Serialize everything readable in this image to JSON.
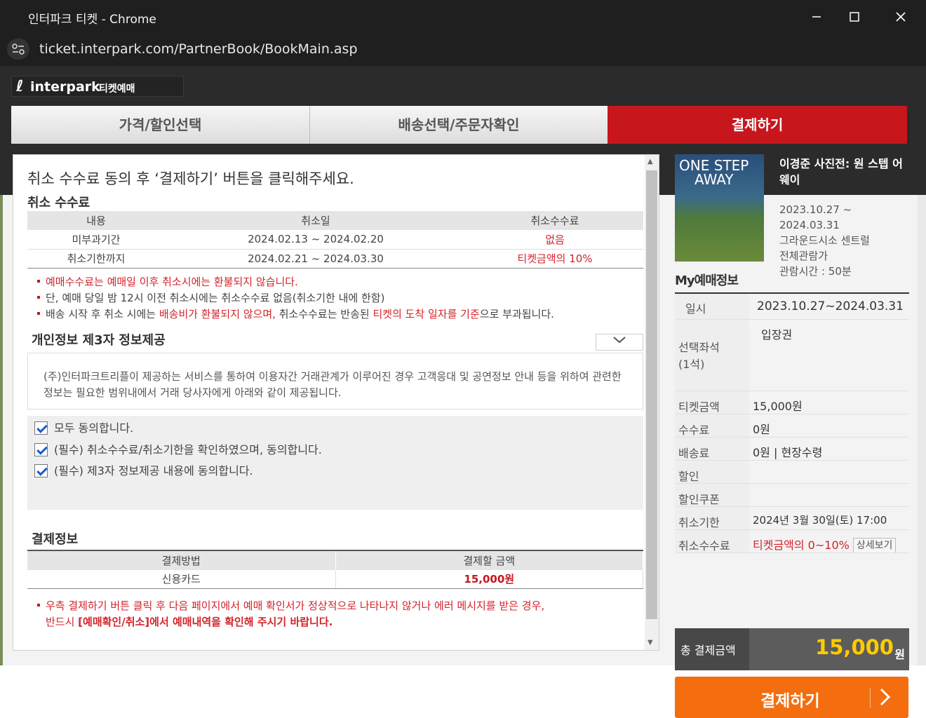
{
  "window": {
    "title": "인터파크 티켓 - Chrome",
    "url": "ticket.interpark.com/PartnerBook/BookMain.asp"
  },
  "logo": {
    "name": "interpark",
    "sub": "티켓예매"
  },
  "steps": [
    "가격/할인선택",
    "배송선택/주문자확인",
    "결제하기"
  ],
  "main": {
    "headline": "취소 수수료 동의 후 ‘결제하기’ 버튼을 클릭해주세요.",
    "cancel_fee": {
      "title": "취소 수수료",
      "headers": [
        "내용",
        "취소일",
        "취소수수료"
      ],
      "rows": [
        [
          "미부과기간",
          "2024.02.13 ~ 2024.02.20",
          "없음"
        ],
        [
          "취소기한까지",
          "2024.02.21 ~ 2024.03.30",
          "티켓금액의 10%"
        ]
      ],
      "notes": {
        "n1": "예매수수료는 예매일 이후 취소시에는 환불되지 않습니다.",
        "n2": "단, 예매 당일 밤 12시 이전 취소시에는 취소수수료 없음(취소기한 내에 한함)",
        "n3a": "배송 시작 후 취소 시에는 ",
        "n3b": "배송비가 환불되지 않으며,",
        "n3c": " 취소수수료는 반송된 ",
        "n3d": "티켓의 도착 일자를 기준",
        "n3e": "으로 부과됩니다."
      }
    },
    "privacy": {
      "title": "개인정보 제3자 정보제공",
      "text": "(주)인터파크트리플이 제공하는 서비스를 통하여 이용자간 거래관계가 이루어진 경우 고객응대 및 공연정보 안내 등을 위하여 관련한 정보는 필요한 범위내에서 거래 당사자에게 아래와 같이 제공됩니다."
    },
    "agree": {
      "all": "모두 동의합니다.",
      "cancel": "(필수) 취소수수료/취소기한을 확인하였으며, 동의합니다.",
      "third": "(필수) 제3자 정보제공 내용에 동의합니다."
    },
    "payment": {
      "title": "결제정보",
      "headers": [
        "결제방법",
        "결제할 금액"
      ],
      "method": "신용카드",
      "amount": "15,000원",
      "note1": "우측 결제하기 버튼 클릭 후 다음 페이지에서 예매 확인서가 정상적으로 나타나지 않거나 에러 메시지를 받은 경우,",
      "note2a": "반드시 ",
      "note2b": "[예매확인/취소]에서 예매내역을 확인해 주시기 바랍니다."
    }
  },
  "sidebar": {
    "poster": {
      "line1": "ONE STEP",
      "line2": "AWAY"
    },
    "show_title": "이경준 사진전: 원 스텝 어웨이",
    "period_start": "2023.10.27 ~",
    "period_end": "2024.03.31",
    "venue": "그라운드시소 센트럴",
    "rating": "전체관람가",
    "runtime": "관람시간 : 50분",
    "my_title": "My예매정보",
    "info": [
      {
        "label": "일시",
        "value": "2023.10.27~2024.03.31"
      },
      {
        "label": "선택좌석\n(1석)",
        "value": "입장권"
      },
      {
        "label": "티켓금액",
        "value": "15,000원"
      },
      {
        "label": "수수료",
        "value": "0원"
      },
      {
        "label": "배송료",
        "value": "0원 | 현장수령"
      },
      {
        "label": "할인",
        "value": ""
      },
      {
        "label": "할인쿠폰",
        "value": ""
      },
      {
        "label": "취소기한",
        "value": "2024년 3월 30일(토) 17:00"
      },
      {
        "label": "취소수수료",
        "value": "티켓금액의 0~10%"
      }
    ],
    "detail_btn": "상세보기",
    "total_label": "총 결제금액",
    "total_amount": "15,000",
    "total_unit": "원",
    "pay_button": "결제하기"
  },
  "colors": {
    "accent_red": "#c8161d",
    "pay_orange": "#f46e0f",
    "total_yellow": "#ffcc00"
  }
}
